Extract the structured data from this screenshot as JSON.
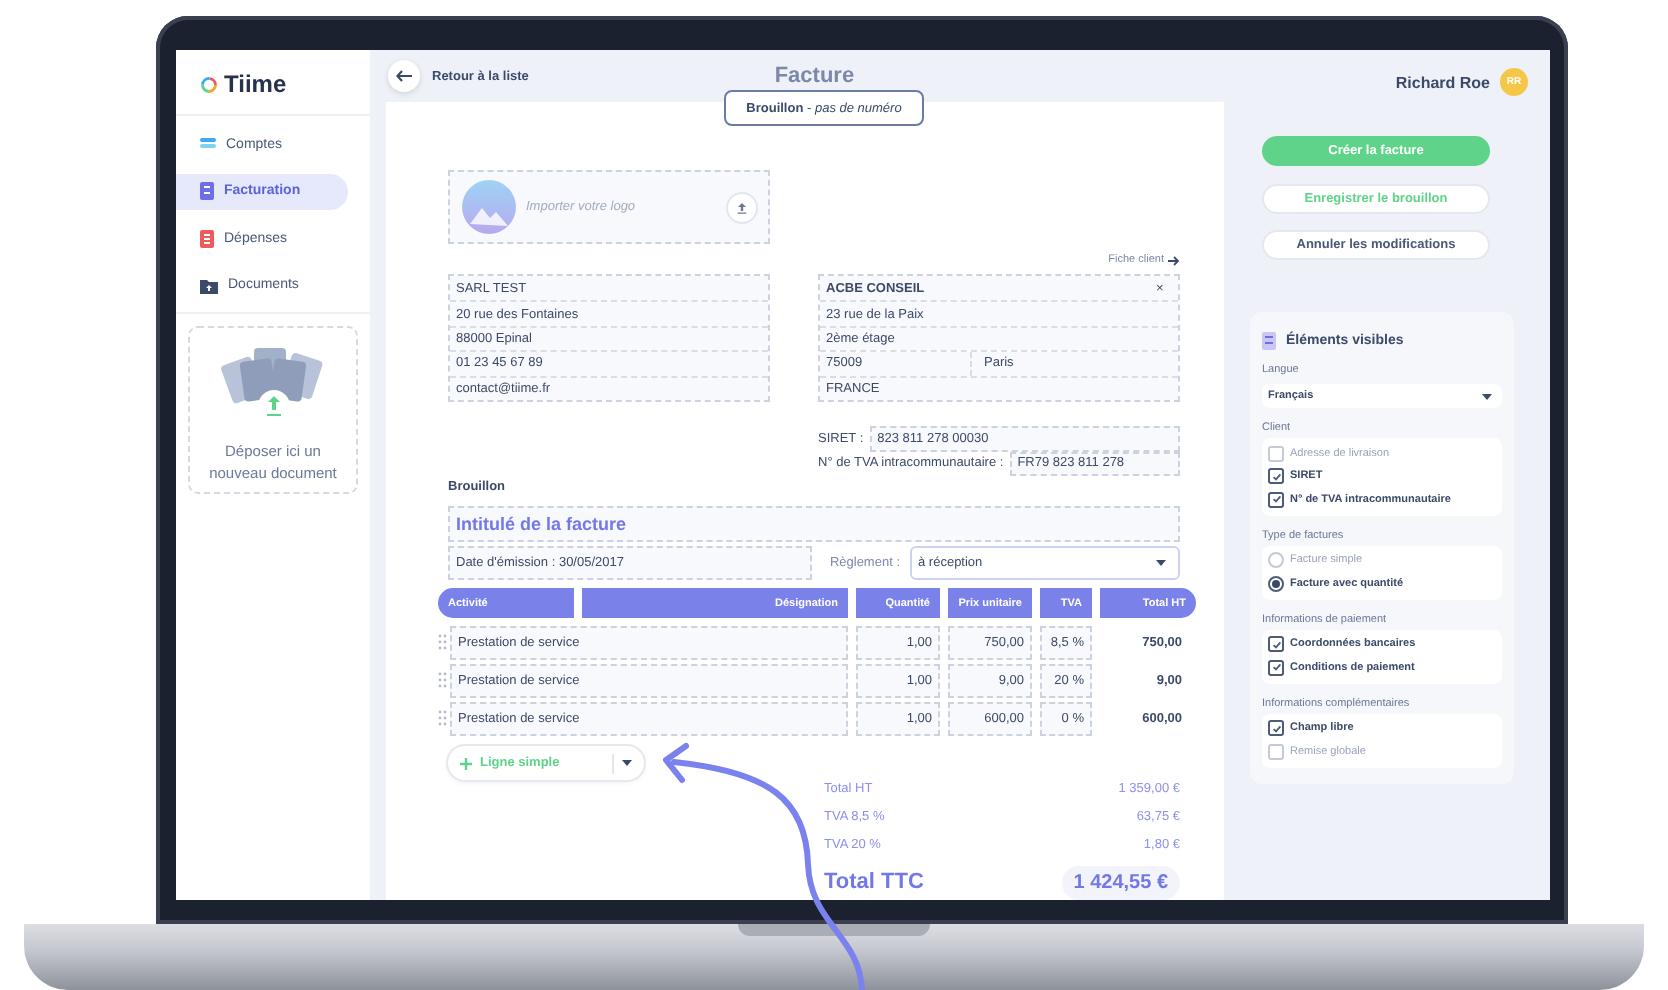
{
  "sidebar": {
    "logo": "Tiime",
    "items": [
      {
        "label": "Comptes",
        "selected": false
      },
      {
        "label": "Facturation",
        "selected": true
      },
      {
        "label": "Dépenses",
        "selected": false
      },
      {
        "label": "Documents",
        "selected": false
      }
    ],
    "dropzone": "Déposer ici un nouveau document"
  },
  "header": {
    "back": "Retour à la liste",
    "title": "Facture",
    "status": "**Brouillon** - *pas de numéro*"
  },
  "user": {
    "name": "Richard Roe",
    "initials": "RR"
  },
  "actions": [
    {
      "label": "Créer la facture",
      "kind": "primary"
    },
    {
      "label": "Enregistrer le brouillon",
      "kind": "outline"
    },
    {
      "label": "Annuler les modifications",
      "kind": "plain"
    }
  ],
  "invoice": {
    "logo_prompt": "Importer votre logo",
    "sender": [
      "SARL TEST",
      "20 rue des Fontaines",
      "88000 Epinal",
      "01 23 45 67 89",
      "contact@tiime.fr"
    ],
    "client_link": "Fiche client",
    "client": {
      "name": "ACBE CONSEIL",
      "remove": "×",
      "address": [
        "23 rue de la Paix",
        "2ème étage"
      ],
      "postcode": "75009",
      "city": "Paris",
      "country": "FRANCE"
    },
    "identifiers": [
      {
        "label": "SIRET :",
        "value": "823 811 278 00030"
      },
      {
        "label": "N° de TVA intracommunautaire :",
        "value": "FR79  823 811 278"
      }
    ],
    "status": "Brouillon",
    "title": "Intitulé de la facture",
    "date": "Date d'émission : 30/05/2017",
    "payment": {
      "label": "Règlement :",
      "value": "à réception"
    },
    "columns": [
      "Activité",
      "Désignation",
      "Quantité",
      "Prix unitaire",
      "TVA",
      "Total HT"
    ],
    "rows": [
      {
        "description": "Prestation de service",
        "quantity": "1,00",
        "unit_price": "750,00",
        "vat": "8,5 %",
        "total": "750,00"
      },
      {
        "description": "Prestation de service",
        "quantity": "1,00",
        "unit_price": "9,00",
        "vat": "20 %",
        "total": "9,00"
      },
      {
        "description": "Prestation de service",
        "quantity": "1,00",
        "unit_price": "600,00",
        "vat": "0 %",
        "total": "600,00"
      }
    ],
    "add_line": "Ligne simple",
    "totals": [
      {
        "label": "Total HT",
        "value": "1 359,00 €"
      },
      {
        "label": "TVA 8,5 %",
        "value": "63,75 €"
      },
      {
        "label": "TVA 20 %",
        "value": "1,80 €"
      }
    ],
    "grand_total": {
      "label": "Total TTC",
      "value": "1 424,55 €"
    }
  },
  "visible_elements": {
    "title": "Éléments visibles",
    "sections": [
      {
        "heading": "Langue",
        "kind": "select",
        "value": "Français"
      },
      {
        "heading": "Client",
        "kind": "checkboxes",
        "items": [
          {
            "label": "Adresse de livraison",
            "checked": false
          },
          {
            "label": "SIRET",
            "checked": true
          },
          {
            "label": "N° de TVA intracommunautaire",
            "checked": true
          }
        ]
      },
      {
        "heading": "Type de factures",
        "kind": "radios",
        "items": [
          {
            "label": "Facture simple",
            "selected": false
          },
          {
            "label": "Facture avec quantité",
            "selected": true
          }
        ]
      },
      {
        "heading": "Informations de paiement",
        "kind": "checkboxes",
        "items": [
          {
            "label": "Coordonnées bancaires",
            "checked": true
          },
          {
            "label": "Conditions de paiement",
            "checked": true
          }
        ]
      },
      {
        "heading": "Informations complémentaires",
        "kind": "checkboxes",
        "items": [
          {
            "label": "Champ libre",
            "checked": true
          },
          {
            "label": "Remise globale",
            "checked": false
          }
        ]
      }
    ]
  }
}
